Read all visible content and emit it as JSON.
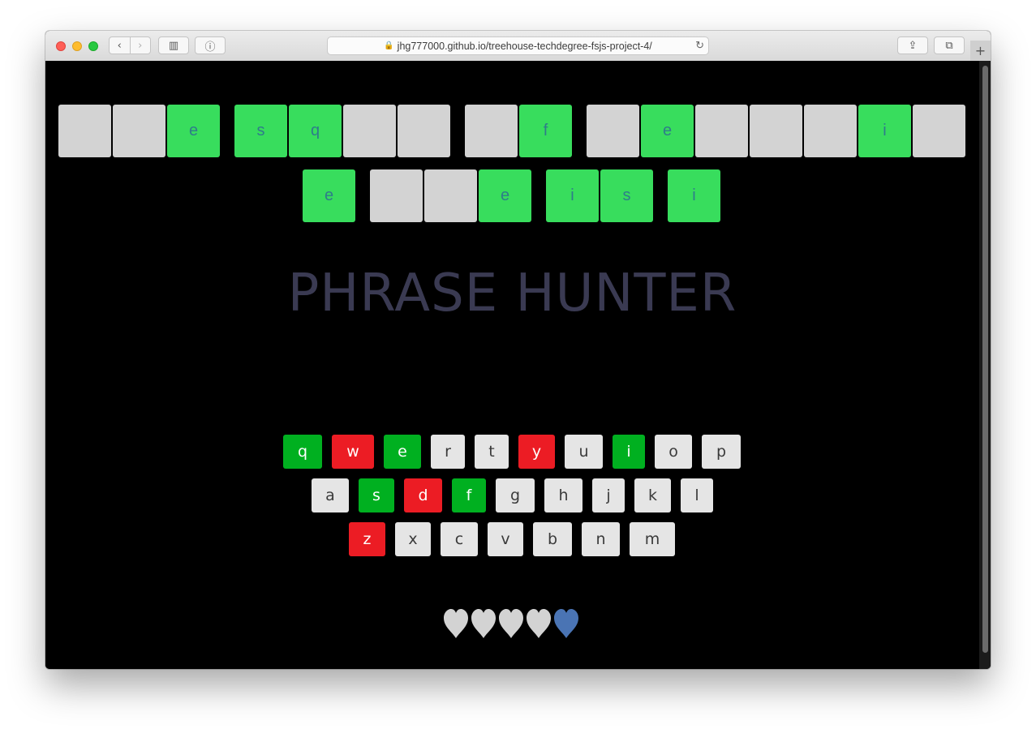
{
  "browser": {
    "url": "jhg777000.github.io/treehouse-techdegree-fsjs-project-4/",
    "back_glyph": "‹",
    "forward_glyph": "›",
    "sidebar_glyph": "▥",
    "info_glyph": "ⓘ",
    "share_glyph": "⇪",
    "tabs_glyph": "⧉",
    "reload_glyph": "↻",
    "newtab_glyph": "+",
    "lock_glyph": "🔒"
  },
  "phrase": {
    "row1": [
      {
        "letter": "",
        "shown": false
      },
      {
        "letter": "",
        "shown": false
      },
      {
        "letter": "e",
        "shown": true
      },
      {
        "space": true
      },
      {
        "letter": "s",
        "shown": true
      },
      {
        "letter": "q",
        "shown": true
      },
      {
        "letter": "",
        "shown": false
      },
      {
        "letter": "",
        "shown": false
      },
      {
        "space": true
      },
      {
        "letter": "",
        "shown": false
      },
      {
        "letter": "f",
        "shown": true
      },
      {
        "space": true
      },
      {
        "letter": "",
        "shown": false
      },
      {
        "letter": "e",
        "shown": true
      },
      {
        "letter": "",
        "shown": false
      },
      {
        "letter": "",
        "shown": false
      },
      {
        "letter": "",
        "shown": false
      },
      {
        "letter": "i",
        "shown": true
      },
      {
        "letter": "",
        "shown": false
      }
    ],
    "row2": [
      {
        "letter": "e",
        "shown": true
      },
      {
        "space": true
      },
      {
        "letter": "",
        "shown": false
      },
      {
        "letter": "",
        "shown": false
      },
      {
        "letter": "e",
        "shown": true
      },
      {
        "space": true
      },
      {
        "letter": "i",
        "shown": true
      },
      {
        "letter": "s",
        "shown": true
      },
      {
        "space": true
      },
      {
        "letter": "i",
        "shown": true
      }
    ]
  },
  "title": "PHRASE HUNTER",
  "keyboard": {
    "rows": [
      [
        {
          "key": "q",
          "state": "chosen"
        },
        {
          "key": "w",
          "state": "wrong"
        },
        {
          "key": "e",
          "state": "chosen"
        },
        {
          "key": "r",
          "state": "none"
        },
        {
          "key": "t",
          "state": "none"
        },
        {
          "key": "y",
          "state": "wrong"
        },
        {
          "key": "u",
          "state": "none"
        },
        {
          "key": "i",
          "state": "chosen"
        },
        {
          "key": "o",
          "state": "none"
        },
        {
          "key": "p",
          "state": "none"
        }
      ],
      [
        {
          "key": "a",
          "state": "none"
        },
        {
          "key": "s",
          "state": "chosen"
        },
        {
          "key": "d",
          "state": "wrong"
        },
        {
          "key": "f",
          "state": "chosen"
        },
        {
          "key": "g",
          "state": "none"
        },
        {
          "key": "h",
          "state": "none"
        },
        {
          "key": "j",
          "state": "none"
        },
        {
          "key": "k",
          "state": "none"
        },
        {
          "key": "l",
          "state": "none"
        }
      ],
      [
        {
          "key": "z",
          "state": "wrong"
        },
        {
          "key": "x",
          "state": "none"
        },
        {
          "key": "c",
          "state": "none"
        },
        {
          "key": "v",
          "state": "none"
        },
        {
          "key": "b",
          "state": "none"
        },
        {
          "key": "n",
          "state": "none"
        },
        {
          "key": "m",
          "state": "none"
        }
      ]
    ]
  },
  "lives": {
    "total": 5,
    "remaining": 1,
    "lost_color": "#d3d3d3",
    "live_color": "#4a74b4"
  },
  "colors": {
    "revealed_tile": "#38dd5d",
    "hidden_tile": "#d3d3d3",
    "key_chosen": "#00b020",
    "key_wrong": "#ec1c24",
    "key_default": "#e5e5e5",
    "title": "#3a3a52"
  }
}
